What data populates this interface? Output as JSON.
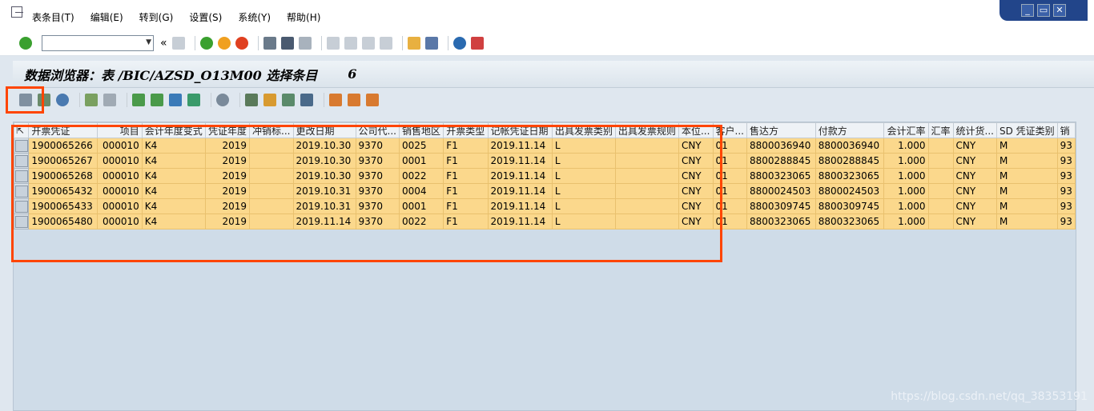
{
  "menu": {
    "items": [
      "表条目(T)",
      "编辑(E)",
      "转到(G)",
      "设置(S)",
      "系统(Y)",
      "帮助(H)"
    ]
  },
  "window_controls": {
    "minimize": "_",
    "restore": "▭",
    "close": "✕"
  },
  "toolbar": {
    "command_value": "",
    "icons": [
      "enter-icon",
      "save-icon",
      "back-icon",
      "exit-icon",
      "cancel-icon",
      "print-icon",
      "find-icon",
      "find-next-icon",
      "first-page-icon",
      "previous-page-icon",
      "next-page-icon",
      "last-page-icon",
      "create-session-icon",
      "shortcut-icon",
      "help-icon",
      "customize-layout-icon"
    ],
    "colors": {
      "enter": "#3aa02f",
      "back": "#3aa02f",
      "exit": "#f0a020",
      "cancel": "#e04020",
      "help": "#2a6ab0"
    }
  },
  "title": {
    "text": "数据浏览器：表 /BIC/AZSD_O13M00 选择条目",
    "count": "6"
  },
  "app_toolbar": {
    "icons": [
      "glasses-details-icon",
      "check-table-icon",
      "refresh-icon",
      "select-all-icon",
      "deselect-all-icon",
      "sort-ascending-icon",
      "sort-descending-icon",
      "filter-icon",
      "total-icon",
      "subtotal-icon",
      "export-excel-icon",
      "print-preview-icon",
      "export-icon",
      "view-icon",
      "layout-icon",
      "choose-layout-icon",
      "save-layout-icon"
    ]
  },
  "table": {
    "columns": [
      {
        "label": "开票凭证",
        "align": "left"
      },
      {
        "label": "项目",
        "align": "right"
      },
      {
        "label": "会计年度变式",
        "align": "left"
      },
      {
        "label": "凭证年度",
        "align": "right"
      },
      {
        "label": "冲销标...",
        "align": "left"
      },
      {
        "label": "更改日期",
        "align": "left"
      },
      {
        "label": "公司代...",
        "align": "left"
      },
      {
        "label": "销售地区",
        "align": "left"
      },
      {
        "label": "开票类型",
        "align": "left"
      },
      {
        "label": "记帐凭证日期",
        "align": "left"
      },
      {
        "label": "出具发票类别",
        "align": "left"
      },
      {
        "label": "出具发票规则",
        "align": "left"
      },
      {
        "label": "本位...",
        "align": "left"
      },
      {
        "label": "客户...",
        "align": "left"
      },
      {
        "label": "售达方",
        "align": "left"
      },
      {
        "label": "付款方",
        "align": "left"
      },
      {
        "label": "会计汇率",
        "align": "right"
      },
      {
        "label": "汇率",
        "align": "left"
      },
      {
        "label": "统计货...",
        "align": "left"
      },
      {
        "label": "SD 凭证类别",
        "align": "left"
      },
      {
        "label": "销",
        "align": "left"
      }
    ],
    "rows": [
      [
        "1900065266",
        "000010",
        "K4",
        "2019",
        "",
        "2019.10.30",
        "9370",
        "0025",
        "F1",
        "2019.11.14",
        "L",
        "",
        "CNY",
        "01",
        "8800036940",
        "8800036940",
        "1.000",
        "",
        "CNY",
        "M",
        "93"
      ],
      [
        "1900065267",
        "000010",
        "K4",
        "2019",
        "",
        "2019.10.30",
        "9370",
        "0001",
        "F1",
        "2019.11.14",
        "L",
        "",
        "CNY",
        "01",
        "8800288845",
        "8800288845",
        "1.000",
        "",
        "CNY",
        "M",
        "93"
      ],
      [
        "1900065268",
        "000010",
        "K4",
        "2019",
        "",
        "2019.10.30",
        "9370",
        "0022",
        "F1",
        "2019.11.14",
        "L",
        "",
        "CNY",
        "01",
        "8800323065",
        "8800323065",
        "1.000",
        "",
        "CNY",
        "M",
        "93"
      ],
      [
        "1900065432",
        "000010",
        "K4",
        "2019",
        "",
        "2019.10.31",
        "9370",
        "0004",
        "F1",
        "2019.11.14",
        "L",
        "",
        "CNY",
        "01",
        "8800024503",
        "8800024503",
        "1.000",
        "",
        "CNY",
        "M",
        "93"
      ],
      [
        "1900065433",
        "000010",
        "K4",
        "2019",
        "",
        "2019.10.31",
        "9370",
        "0001",
        "F1",
        "2019.11.14",
        "L",
        "",
        "CNY",
        "01",
        "8800309745",
        "8800309745",
        "1.000",
        "",
        "CNY",
        "M",
        "93"
      ],
      [
        "1900065480",
        "000010",
        "K4",
        "2019",
        "",
        "2019.11.14",
        "9370",
        "0022",
        "F1",
        "2019.11.14",
        "L",
        "",
        "CNY",
        "01",
        "8800323065",
        "8800323065",
        "1.000",
        "",
        "CNY",
        "M",
        "93"
      ]
    ],
    "row_color": "#fbd88c"
  },
  "highlight_color": "#ff4500",
  "watermark": "https://blog.csdn.net/qq_38353191"
}
